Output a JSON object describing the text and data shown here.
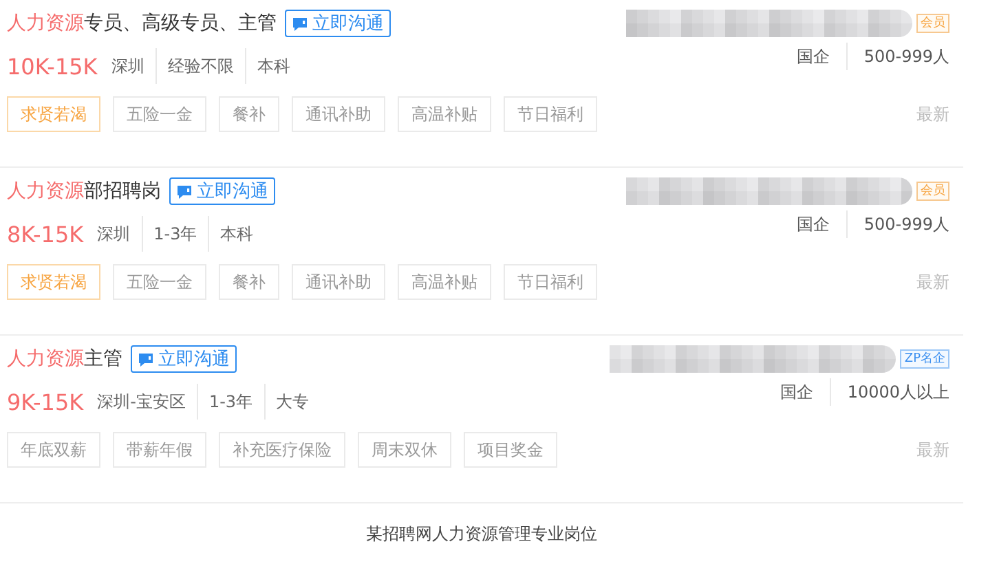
{
  "jobs": [
    {
      "keyword": "人力资源",
      "title_rest": "专员、高级专员、主管",
      "chat_label": "立即沟通",
      "salary": "10K-15K",
      "meta": [
        "深圳",
        "经验不限",
        "本科"
      ],
      "badge": {
        "kind": "member",
        "label": "会员"
      },
      "company_meta": [
        "国企",
        "500-999人"
      ],
      "tags": [
        {
          "label": "求贤若渴",
          "highlight": true
        },
        {
          "label": "五险一金",
          "highlight": false
        },
        {
          "label": "餐补",
          "highlight": false
        },
        {
          "label": "通讯补助",
          "highlight": false
        },
        {
          "label": "高温补贴",
          "highlight": false
        },
        {
          "label": "节日福利",
          "highlight": false
        }
      ],
      "time": "最新"
    },
    {
      "keyword": "人力资源",
      "title_rest": "部招聘岗",
      "chat_label": "立即沟通",
      "salary": "8K-15K",
      "meta": [
        "深圳",
        "1-3年",
        "本科"
      ],
      "badge": {
        "kind": "member",
        "label": "会员"
      },
      "company_meta": [
        "国企",
        "500-999人"
      ],
      "tags": [
        {
          "label": "求贤若渴",
          "highlight": true
        },
        {
          "label": "五险一金",
          "highlight": false
        },
        {
          "label": "餐补",
          "highlight": false
        },
        {
          "label": "通讯补助",
          "highlight": false
        },
        {
          "label": "高温补贴",
          "highlight": false
        },
        {
          "label": "节日福利",
          "highlight": false
        }
      ],
      "time": "最新"
    },
    {
      "keyword": "人力资源",
      "title_rest": "主管",
      "chat_label": "立即沟通",
      "salary": "9K-15K",
      "meta": [
        "深圳-宝安区",
        "1-3年",
        "大专"
      ],
      "badge": {
        "kind": "zp",
        "label": "ZP名企"
      },
      "company_meta": [
        "国企",
        "10000人以上"
      ],
      "tags": [
        {
          "label": "年底双薪",
          "highlight": false
        },
        {
          "label": "带薪年假",
          "highlight": false
        },
        {
          "label": "补充医疗保险",
          "highlight": false
        },
        {
          "label": "周末双休",
          "highlight": false
        },
        {
          "label": "项目奖金",
          "highlight": false
        }
      ],
      "time": "最新"
    }
  ],
  "caption": "某招聘网人力资源管理专业岗位"
}
